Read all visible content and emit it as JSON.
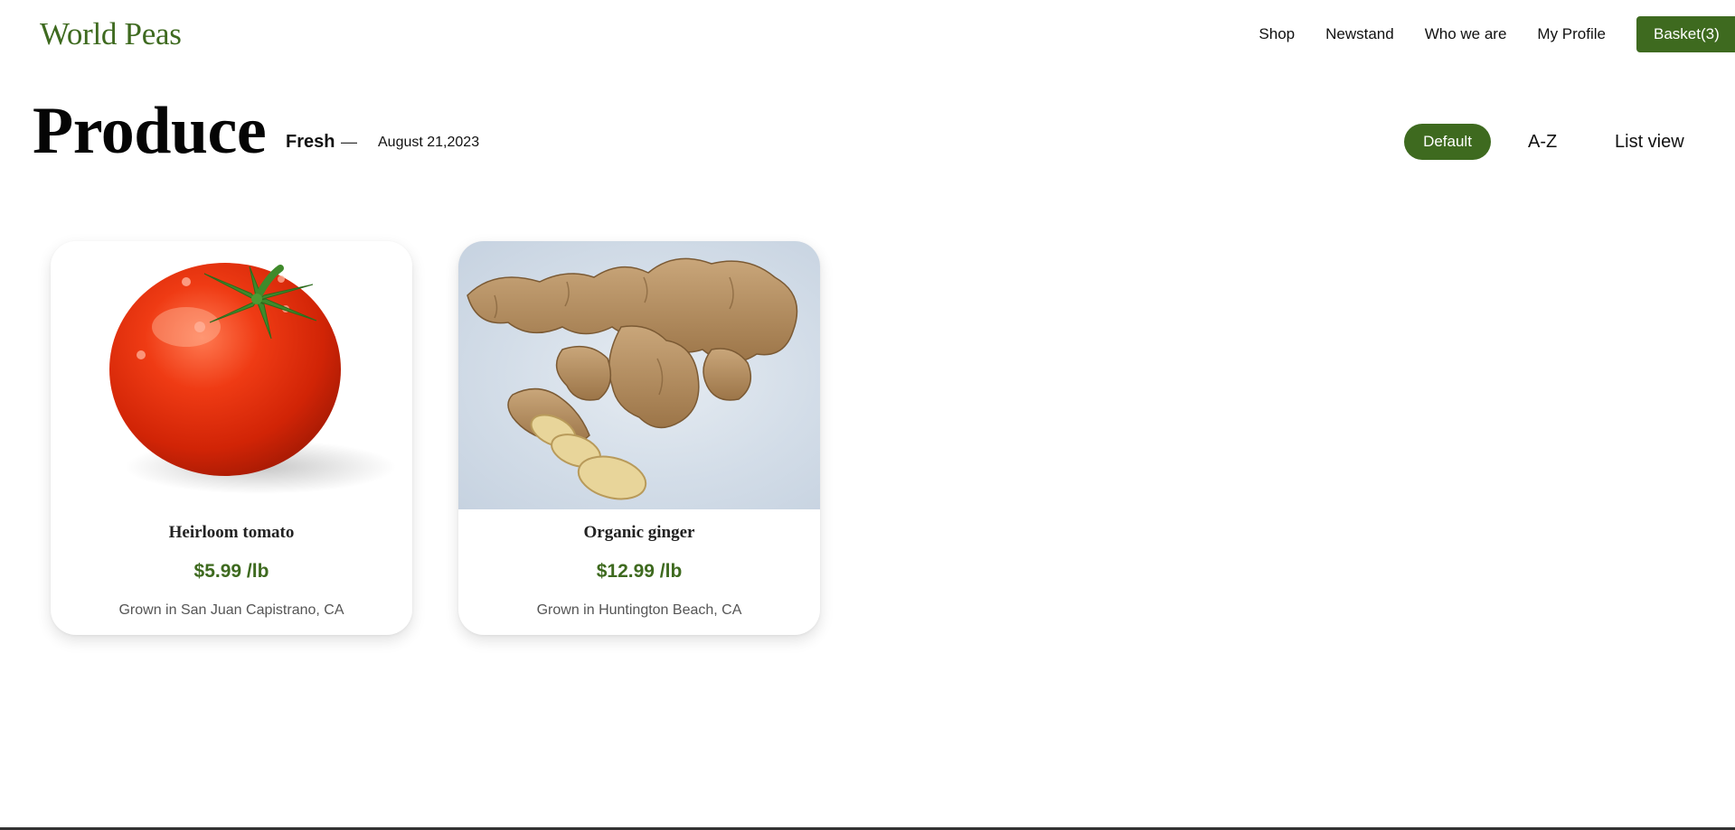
{
  "header": {
    "logo": "World Peas",
    "nav": [
      "Shop",
      "Newstand",
      "Who we are",
      "My Profile"
    ],
    "basket_label": "Basket(3)"
  },
  "page": {
    "title": "Produce",
    "subtitle_label": "Fresh",
    "subtitle_dash": "—",
    "date": "August 21,2023"
  },
  "controls": {
    "sort_default": "Default",
    "sort_az": "A-Z",
    "view_list": "List view"
  },
  "products": [
    {
      "name": "Heirloom tomato",
      "price": "$5.99 /lb",
      "origin": "Grown in San Juan Capistrano, CA",
      "image_icon": "tomato-image"
    },
    {
      "name": "Organic ginger",
      "price": "$12.99 /lb",
      "origin": "Grown in Huntington Beach, CA",
      "image_icon": "ginger-image"
    }
  ],
  "colors": {
    "brand_green": "#3e6a1f",
    "text": "#111111",
    "muted": "#555555"
  }
}
